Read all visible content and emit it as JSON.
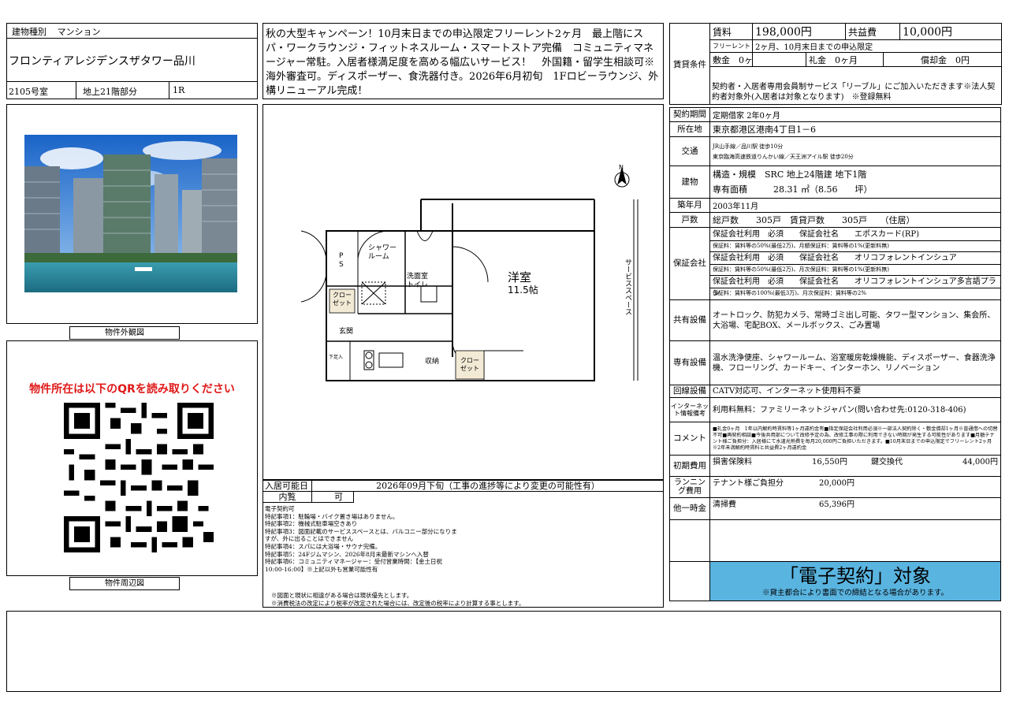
{
  "building_type_label": "建物種別",
  "building_type": "マンション",
  "property_name": "フロンティアレジデンスザタワー品川",
  "room_number": "2105号室",
  "floor": "地上21階部分",
  "layout": "1R",
  "campaign_text": "秋の大型キャンペーン！10月末日までの申込限定フリーレント2ヶ月　最上階にスパ・ワークラウンジ・フィットネスルーム・スマートストア完備　コミュニティマネージャー常駐。入居者様満足度を高める幅広いサービス！　外国籍・留学生相談可※海外審査可。ディスポーザー、食洗器付き。2026年6月初旬　1Fロビーラウンジ、外構リニューアル完成！",
  "exterior_caption": "物件外観図",
  "qr_heading": "物件所在は以下のQRを読み取りください",
  "surroundings_caption": "物件周辺図",
  "floorplan": {
    "room_name": "洋室",
    "room_size": "11.5帖",
    "shower": "シャワー\nルーム",
    "washroom": "洗面室\nトイレ",
    "ps": "P\nS",
    "closet_left": "クロー\nゼット",
    "closet_bottom": "クロー\nゼット",
    "storage": "収納",
    "entrance": "玄関",
    "shoe": "下足入",
    "service_space": "サービススペース",
    "north": "N"
  },
  "fees": {
    "rent_label": "賃料",
    "rent": "198,000円",
    "common_label": "共益費",
    "common": "10,000円",
    "section_label": "賃貸条件",
    "free_rent_label": "フリーレント",
    "free_rent": "2ヶ月、10月末日までの申込限定",
    "deposit_label": "敷金",
    "deposit": "0ヶ月",
    "key_money_label": "礼金",
    "key_money": "0ヶ月",
    "amortization_label": "償却金",
    "amortization": "0円",
    "note": "契約者・入居者専用会員制サービス「リーブル」にご加入いただきます※法人契約者対象外(入居者は対象となります)　※登録無料"
  },
  "details": {
    "contract_period_label": "契約期間",
    "contract_period": "定期借家 2年0ヶ月",
    "location_label": "所在地",
    "location": "東京都港区港南4丁目1－6",
    "transport_label": "交通",
    "transport_1": "JR山手線／品川駅 徒歩10分",
    "transport_2": "東京臨海高速鉄道りんかい線／天王洲アイル駅 徒歩20分",
    "building_label": "建物",
    "structure": "構造・規模　SRC 地上24階建 地下1階",
    "area": "専有面積　　　28.31 ㎡（8.56　　坪）",
    "built_label": "築年月",
    "built": "2003年11月",
    "units_label": "戸数",
    "units": "総戸数　　305戸　賃貸戸数　　305戸　　（住居）",
    "guarantee_label": "保証会社",
    "guarantee_1_main": "保証会社利用　必須　　保証会社名　　エポスカード(RP)",
    "guarantee_1_sub": "保証料：賃料等の50%(最低2万)、月額保証料：賃料等の1%(更新料無)",
    "guarantee_2_main": "保証会社利用　必須　　保証会社名　　オリコフォレントインシュア",
    "guarantee_2_sub": "保証料：賃料等の50%(最低2万)、月次保証料：賃料等の1%(更新料無)",
    "guarantee_3_main": "保証会社利用　必須　　保証会社名　　オリコフォレントインシュア多言語プラン",
    "guarantee_3_sub": "保証料：賃料等の100%(最低3万)、月次保証料：賃料等の2%",
    "shared_label": "共有設備",
    "shared": "オートロック、防犯カメラ、常時ゴミ出し可能、タワー型マンション、集会所、大浴場、宅配BOX、メールボックス、ごみ置場",
    "private_label": "専有設備",
    "private": "温水洗浄便座、シャワールーム、浴室暖房乾燥機能、ディスポーザー、食器洗浄機、フローリング、カードキー、インターホン、リノベーション",
    "line_label": "回線設備",
    "line": "CATV対応可、インターネット使用料不要",
    "internet_label": "インターネット情報備考",
    "internet": "利用料無料：ファミリーネットジャパン(問い合わせ先:0120-318-406)",
    "comment_label": "コメント",
    "comment": "■礼金0ヶ月　1年以内解約時賃料等1ヶ月違約金有■指定保証会社利用必須※一部法人契約除く・敷金償却1ヶ月※普通借への切替不可■再契約相談■今後共用部について改修予定の為、改修工事の際に利用できない時期が発生する可能性があります■月額テナント様ご負担分：入居様にて水道光熱費を毎月20,000円ご負担いただきます。■10月末日までの申込限定でフリーレント2ヶ月※2年未満解約時賃料と共益費2ヶ月違約金",
    "initial_label": "初期費用",
    "initial_1_name": "損害保険料",
    "initial_1_value": "16,550円",
    "initial_2_name": "鍵交換代",
    "initial_2_value": "44,000円",
    "running_label": "ランニング費用",
    "running_name": "テナント様ご負担分",
    "running_value": "20,000円",
    "onetime_label": "他一時金",
    "onetime_name": "清掃費",
    "onetime_value": "65,396円"
  },
  "econtract_title": "「電子契約」対象",
  "econtract_note": "※貸主都合により書面での締結となる場合があります。",
  "move_in_label": "入居可能日",
  "move_in": "2026年09月下旬（工事の進捗等により変更の可能性有）",
  "viewing_label": "内覧",
  "viewing": "可",
  "remarks": [
    "電子契約可",
    "特記事項1：駐輪場・バイク置き場はありません。",
    "特記事項2：機械式駐車場空きあり",
    "特記事項3：図面記載のサービススペースとは、バルコニー部分になりますが、外に出ることはできません",
    "特記事項4：スパには大浴場・サウナ完備。",
    "特記事項5：24Fジムマシン、2026年8月末最新マシンへ入替",
    "特記事項6：コミュニティマネージャー：受付営業時間：【金土日祝　10:00-16:00】※上記以外も営業可能性有"
  ],
  "footnote_1": "※図面と現状に相違がある場合は現状優先とします。",
  "footnote_2": "※消費税法の改定により税率が改定された場合には、改定後の税率により計算する事とします。",
  "colors": {
    "red": "#e01818",
    "econtract_bg": "#5ab4e0",
    "closet_fill": "#f3ead6"
  }
}
